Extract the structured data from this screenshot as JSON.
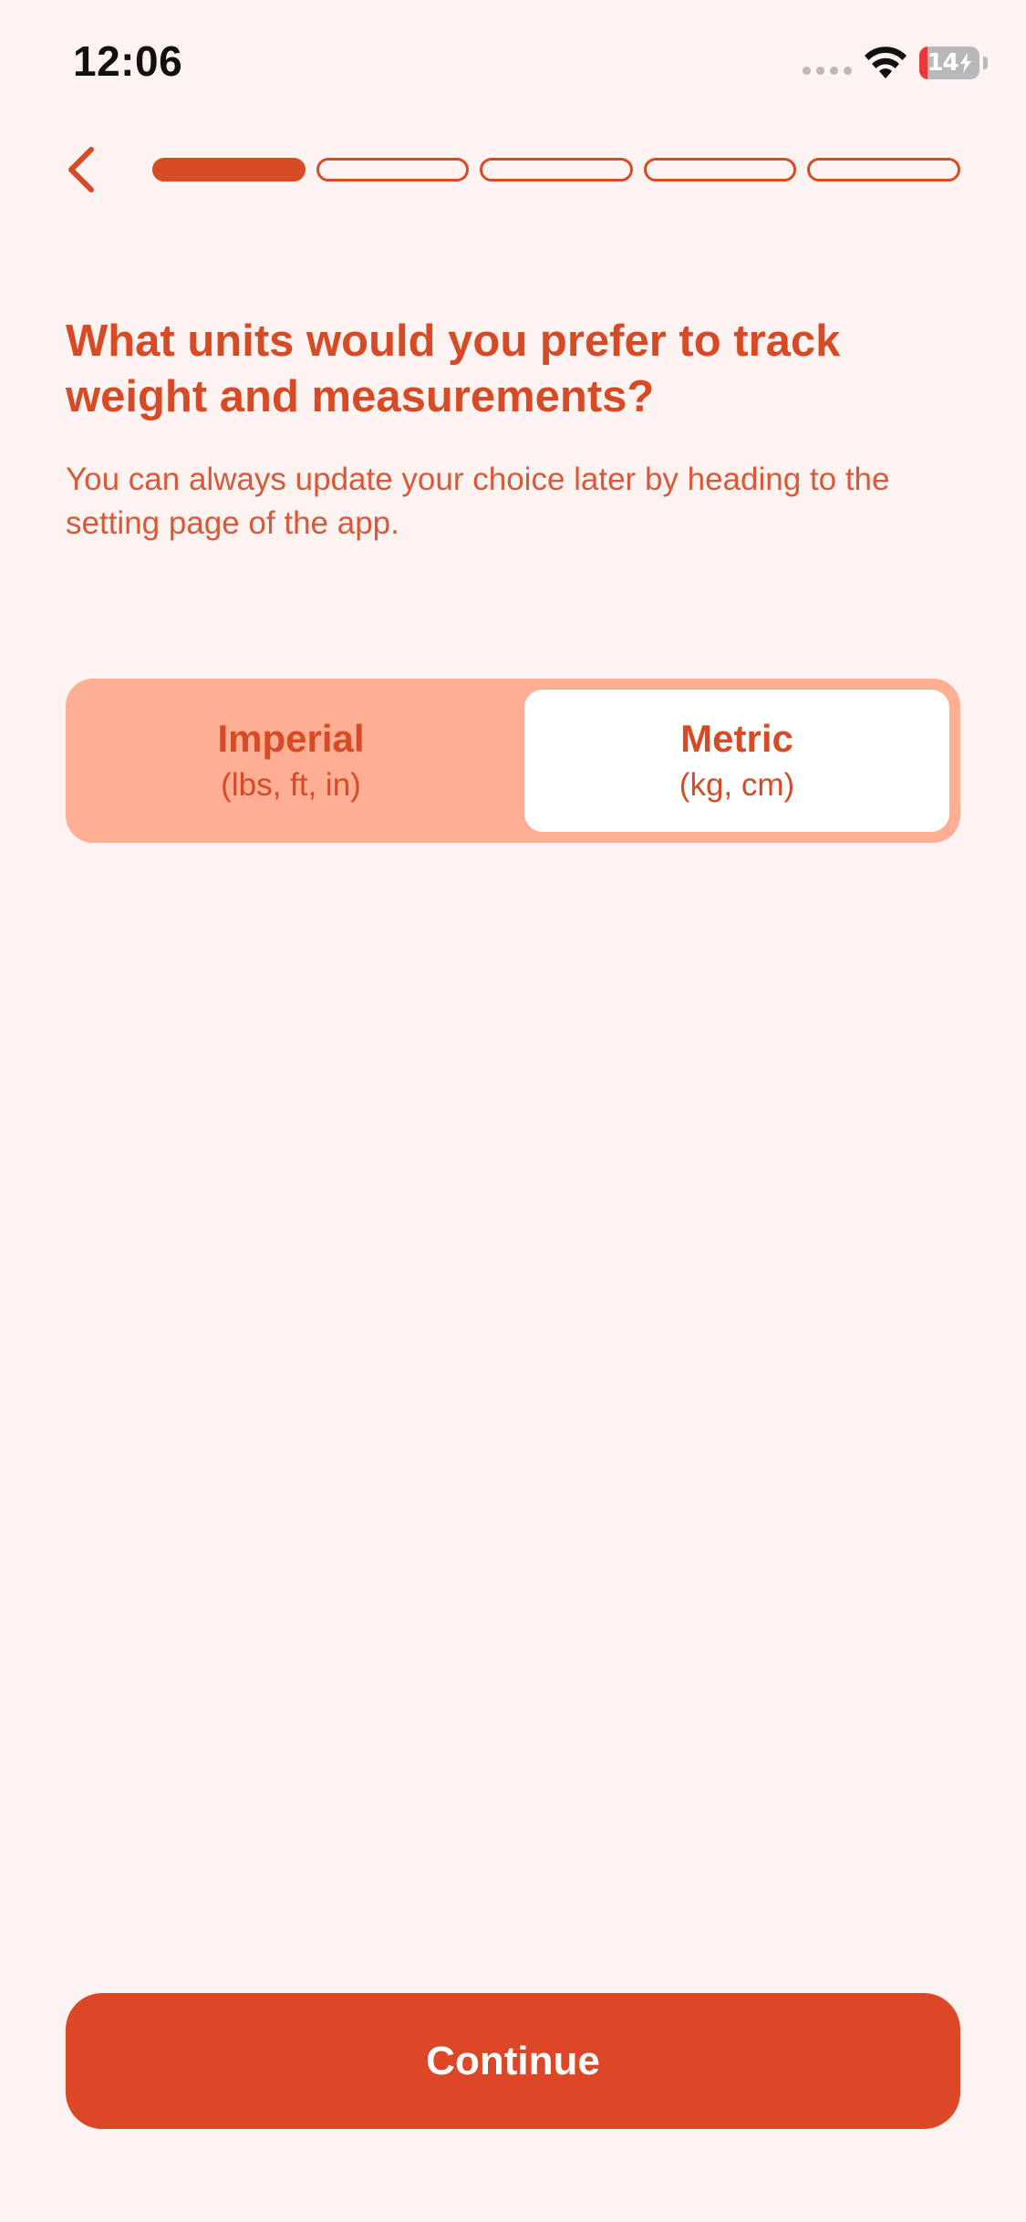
{
  "status_bar": {
    "time": "12:06",
    "battery_text": "14",
    "battery_level": 0.14
  },
  "progress": {
    "total_steps": 5,
    "current_step": 1
  },
  "question": {
    "title": "What units would you prefer to track weight and measurements?",
    "subtitle": "You can always update your choice later by heading to the setting page of the app."
  },
  "units": {
    "selected": "Metric",
    "options": [
      {
        "name": "Imperial",
        "detail": "(lbs, ft, in)"
      },
      {
        "name": "Metric",
        "detail": "(kg, cm)"
      }
    ]
  },
  "footer": {
    "continue_label": "Continue"
  },
  "colors": {
    "accent": "#d64a26",
    "background": "#fff3f1",
    "toggle_track": "#ffad93",
    "button": "#dc4727",
    "battery_low": "#e53a37"
  },
  "icons": {
    "back": "chevron-left-icon",
    "wifi": "wifi-icon",
    "battery": "battery-charging-icon",
    "signal": "cellular-signal-icon"
  }
}
